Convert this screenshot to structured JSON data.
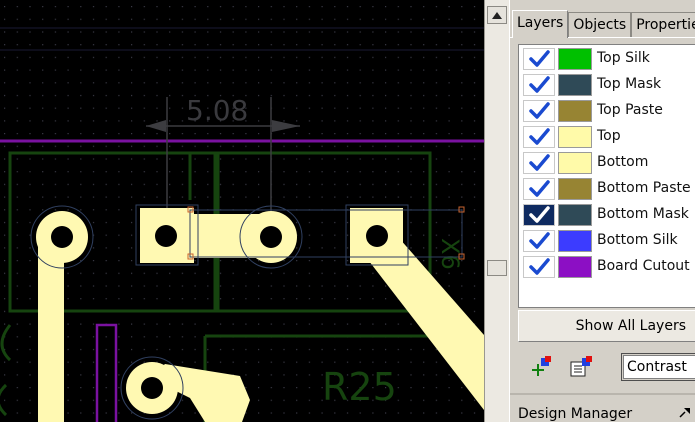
{
  "canvas": {
    "dimension_value": "5.08",
    "component_label": "R25",
    "rotated_label": "X6",
    "colors": {
      "background": "#000000",
      "grid_dot": "#3a3a46",
      "copper": "#fff9b2",
      "silk": "#16440f",
      "cutout": "#7a12a0",
      "dimension": "#3c3c40",
      "selection": "#304060"
    }
  },
  "scrollbar": {
    "up_icon": "arrow-up-icon"
  },
  "panel": {
    "tabs": [
      {
        "label": "Layers",
        "active": true
      },
      {
        "label": "Objects",
        "active": false
      },
      {
        "label": "Properties",
        "active": false
      }
    ],
    "layers": [
      {
        "name": "Top Silk",
        "color": "#00c000",
        "checked": true
      },
      {
        "name": "Top Mask",
        "color": "#2f4a57",
        "checked": true
      },
      {
        "name": "Top Paste",
        "color": "#978433",
        "checked": true
      },
      {
        "name": "Top",
        "color": "#fffaa9",
        "checked": true
      },
      {
        "name": "Bottom",
        "color": "#fffaa9",
        "checked": true
      },
      {
        "name": "Bottom Paste",
        "color": "#978433",
        "checked": true
      },
      {
        "name": "Bottom Mask",
        "color": "#2f4a57",
        "checked": true,
        "focused": true
      },
      {
        "name": "Bottom Silk",
        "color": "#3c3cff",
        "checked": true
      },
      {
        "name": "Board Cutout",
        "color": "#8c0fc4",
        "checked": true
      }
    ],
    "show_all_label": "Show All Layers",
    "contrast_value": "Contrast",
    "toolbar_icons": [
      "add-layer-icon",
      "layer-properties-icon"
    ]
  },
  "design_manager": {
    "title": "Design Manager",
    "pin_icon": "pin-icon"
  }
}
